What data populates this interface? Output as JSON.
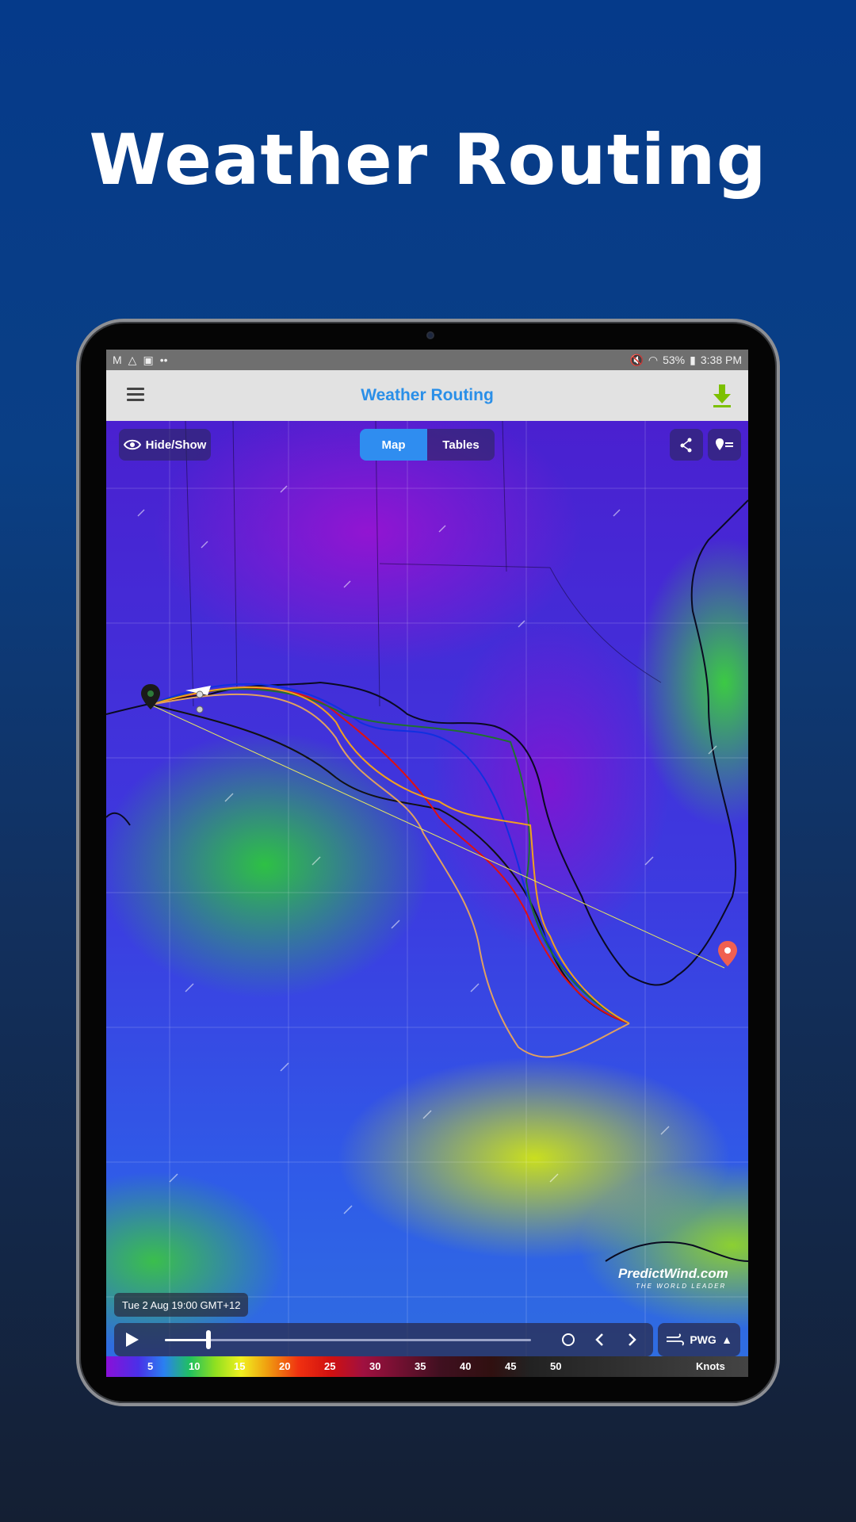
{
  "hero": {
    "title": "Weather Routing"
  },
  "statusbar": {
    "battery": "53%",
    "time": "3:38 PM",
    "left_icons": [
      "gmail-icon",
      "drive-icon",
      "gallery-icon"
    ],
    "more": "••"
  },
  "appbar": {
    "title": "Weather Routing",
    "menu_icon": "menu-icon",
    "download_icon": "download-icon",
    "accent": "#2a8fe8",
    "download_color": "#7cc000"
  },
  "controls": {
    "hide_show_label": "Hide/Show",
    "tabs": [
      {
        "label": "Map",
        "active": true
      },
      {
        "label": "Tables",
        "active": false
      }
    ],
    "route_icon": "route-share-icon",
    "pin_icon": "pin-list-icon"
  },
  "timestamp": "Tue 2 Aug 19:00 GMT+12",
  "player": {
    "progress": 0.12,
    "model_label": "PWG"
  },
  "brand": {
    "name": "PredictWind.com",
    "tagline": "THE WORLD LEADER"
  },
  "legend": {
    "values": [
      "5",
      "10",
      "15",
      "20",
      "25",
      "30",
      "35",
      "40",
      "45",
      "50"
    ],
    "unit": "Knots"
  }
}
